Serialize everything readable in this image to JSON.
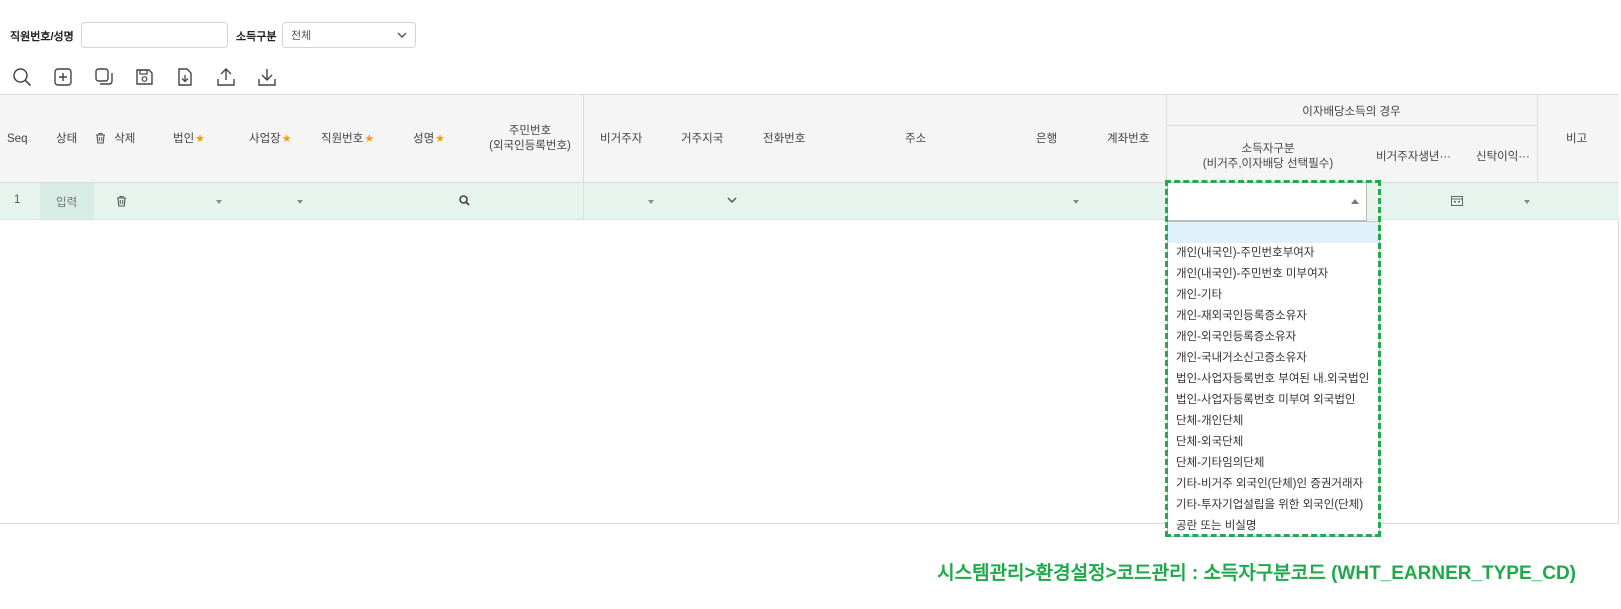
{
  "search": {
    "employee_label": "직원번호/성명",
    "employee_value": "",
    "income_type_label": "소득구분",
    "income_type_value": "전체"
  },
  "toolbar": {
    "icons": [
      "search-icon",
      "add-icon",
      "copy-icon",
      "save-icon",
      "file-download-icon",
      "upload-icon",
      "download-icon"
    ]
  },
  "grid": {
    "headers": {
      "seq": "Seq",
      "status": "상태",
      "delete": "삭제",
      "corp": "법인",
      "biz": "사업장",
      "emp_no": "직원번호",
      "name": "성명",
      "rrn_line1": "주민번호",
      "rrn_line2": "(외국인등록번호)",
      "nonresident": "비거주자",
      "residence": "거주지국",
      "phone": "전화번호",
      "address": "주소",
      "bank": "은행",
      "account": "계좌번호",
      "group_interest": "이자배당소득의 경우",
      "earner_type_line1": "소득자구분",
      "earner_type_line2": "(비거주,이자배당 선택필수)",
      "nonres_birth": "비거주자생년···",
      "trust": "신탁이익···",
      "remark": "비고"
    },
    "rows": [
      {
        "seq": "1",
        "status": "입력"
      }
    ]
  },
  "dropdown": {
    "options": [
      "",
      "개인(내국인)-주민번호부여자",
      "개인(내국인)-주민번호 미부여자",
      "개인-기타",
      "개인-재외국인등록증소유자",
      "개인-외국인등록증소유자",
      "개인-국내거소신고증소유자",
      "법인-사업자등록번호 부여된 내.외국법인",
      "법인-사업자등록번호 미부여 외국법인",
      "단체-개인단체",
      "단체-외국단체",
      "단체-기타임의단체",
      "기타-비거주 외국인(단체)인 증권거래자",
      "기타-투자기업설립을 위한 외국인(단체)",
      "공란 또는 비실명"
    ]
  },
  "annotation": "시스템관리>환경설정>코드관리 : 소득자구분코드 (WHT_EARNER_TYPE_CD)",
  "colors": {
    "accent_green": "#1fa94a",
    "row_bg": "#e7f4ee",
    "required_star": "#f39c12"
  }
}
